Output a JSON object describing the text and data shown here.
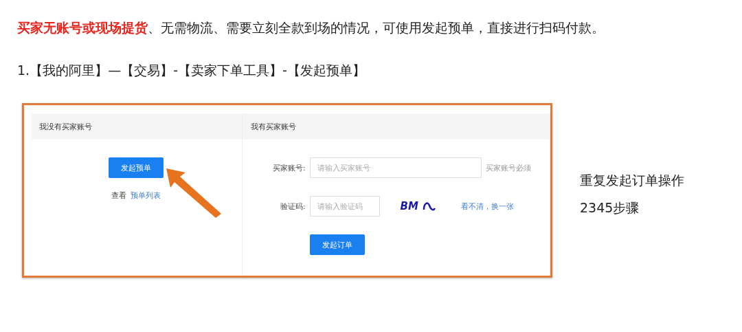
{
  "intro": "**买家无账号或现场提货**、无需物流、需要立刻全款到场的情况，可使用发起预单，直接进行扫码付款。",
  "step": "1.【我的阿里】—【交易】-【卖家下单工具】-【发起预单】",
  "screenshot": {
    "left": {
      "title": "我没有买家账号",
      "button": "发起预单",
      "view_label": "查看",
      "view_link": "预单列表"
    },
    "right": {
      "title": "我有买家账号",
      "account_label": "买家账号:",
      "account_placeholder": "请输入买家账号",
      "account_hint": "买家账号必须",
      "code_label": "验证码:",
      "code_placeholder": "请输入验证码",
      "captcha": "BM",
      "refresh_link": "看不清，换一张",
      "button": "发起订单"
    }
  },
  "notes": [
    "重复发起订单操作",
    "2345步骤"
  ]
}
